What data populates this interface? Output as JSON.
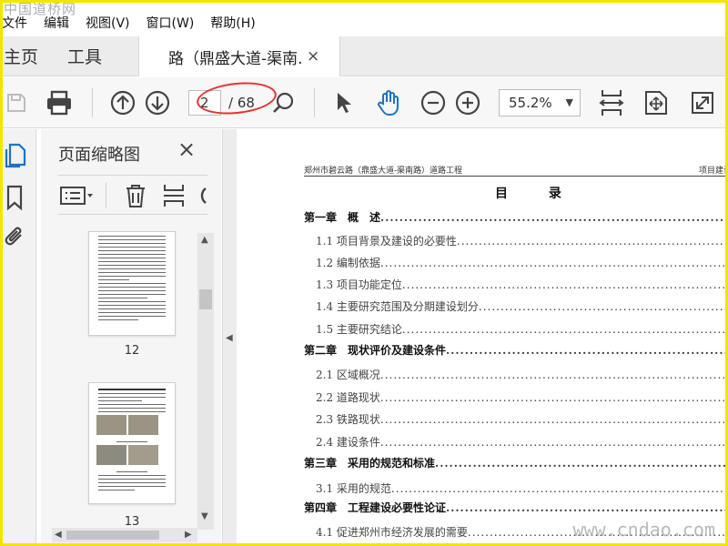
{
  "watermark": {
    "top": "中国道桥网",
    "bottom": "www.cndao.com"
  },
  "menu": [
    "文件",
    "编辑",
    "视图(V)",
    "窗口(W)",
    "帮助(H)"
  ],
  "tabs": {
    "home": "主页",
    "tools": "工具",
    "document": "路（鼎盛大道-渠南...",
    "close": "×"
  },
  "toolbar": {
    "page_current": "2",
    "page_total": "/ 68",
    "zoom": "55.2%"
  },
  "thumbs_panel": {
    "title": "页面缩略图",
    "close": "×",
    "pages": [
      {
        "label": "12"
      },
      {
        "label": "13"
      }
    ]
  },
  "document": {
    "header_left": "郑州市碧云路（鼎盛大道-渠南路）道路工程",
    "header_right": "项目建议",
    "toc_title": "目 录",
    "toc": [
      {
        "text": "第一章　概　述",
        "level": "chapter"
      },
      {
        "text": "1.1 项目背景及建设的必要性",
        "level": "sub"
      },
      {
        "text": "1.2 编制依据",
        "level": "sub"
      },
      {
        "text": "1.3 项目功能定位",
        "level": "sub"
      },
      {
        "text": "1.4 主要研究范围及分期建设划分",
        "level": "sub"
      },
      {
        "text": "1.5 主要研究结论",
        "level": "sub"
      },
      {
        "text": "第二章　现状评价及建设条件",
        "level": "chapter"
      },
      {
        "text": "2.1 区域概况",
        "level": "sub"
      },
      {
        "text": "2.2 道路现状",
        "level": "sub"
      },
      {
        "text": "2.3 铁路现状",
        "level": "sub"
      },
      {
        "text": "2.4 建设条件",
        "level": "sub"
      },
      {
        "text": "第三章　采用的规范和标准",
        "level": "chapter"
      },
      {
        "text": "3.1 采用的规范",
        "level": "sub"
      },
      {
        "text": "第四章　工程建设必要性论证",
        "level": "chapter"
      },
      {
        "text": "4.1 促进郑州市经济发展的需要",
        "level": "sub"
      }
    ]
  },
  "colors": {
    "frame": "#f2e600",
    "annotation": "#e53232",
    "hand_tool": "#1a73c8"
  }
}
